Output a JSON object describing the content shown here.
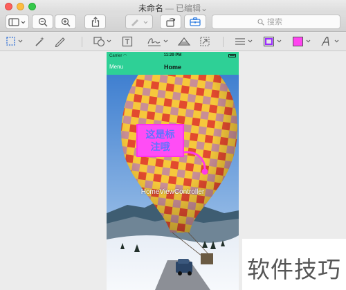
{
  "window": {
    "title": "未命名",
    "separator": "—",
    "state": "已编辑",
    "state_chevron": "⌄"
  },
  "toolbar": {
    "search_placeholder": "搜索",
    "buttons": [
      "sidebar-toggle",
      "zoom-out",
      "zoom-in",
      "share",
      "markup-pen",
      "rotate",
      "toolbox"
    ]
  },
  "markup_toolbar": {
    "tools": [
      "rectangular-selection",
      "instant-alpha",
      "sketch",
      "shapes",
      "text",
      "sign",
      "adjust-color",
      "adjust-size",
      "shape-style",
      "border-color",
      "fill-color",
      "text-style"
    ],
    "border_color": "#9b2cff",
    "fill_color": "#ff44f0"
  },
  "phone": {
    "carrier": "Carrier",
    "time": "11:29 PM",
    "nav_left": "Menu",
    "nav_title": "Home",
    "controller_label": "HomeViewController",
    "accent_color": "#2ed096"
  },
  "annotation": {
    "line1": "这是标",
    "line2": "注哦"
  },
  "watermark": {
    "text": "软件技巧"
  }
}
